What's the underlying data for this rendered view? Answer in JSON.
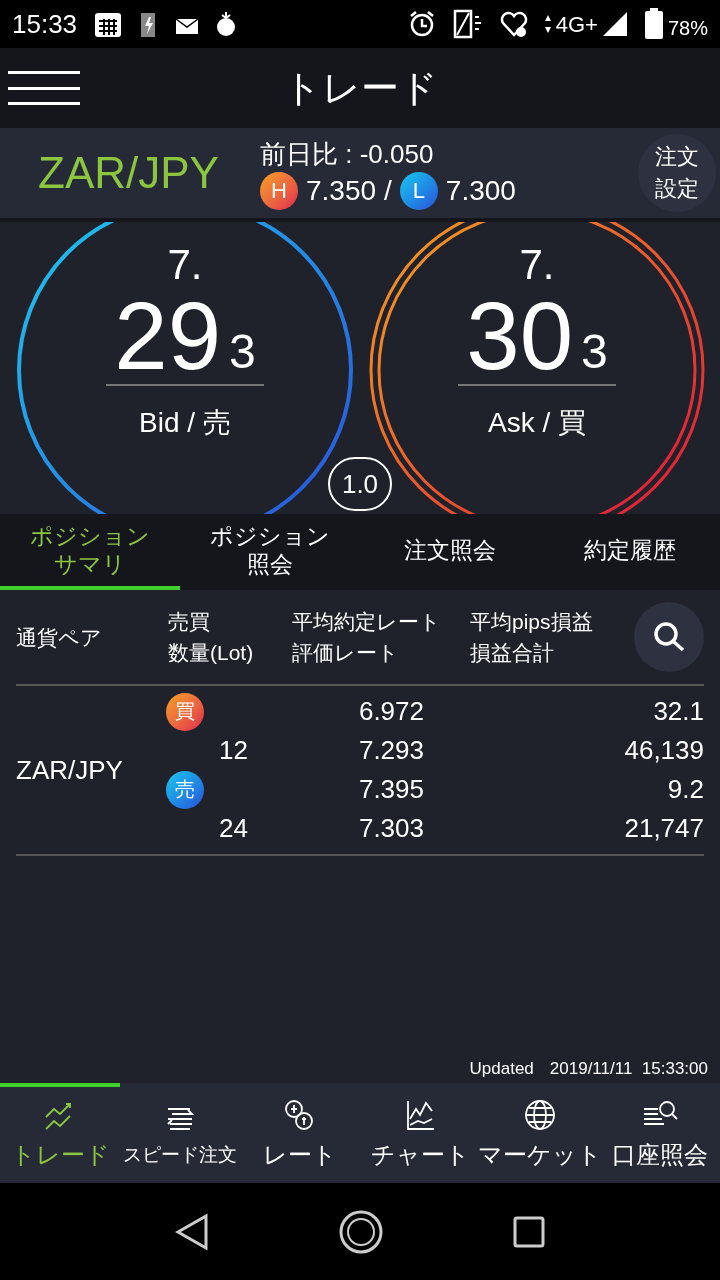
{
  "status_bar": {
    "time": "15:33",
    "network": "4G+",
    "battery": "78%"
  },
  "header": {
    "title": "トレード"
  },
  "pair_info": {
    "pair": "ZAR/JPY",
    "change": "前日比 : -0.050",
    "high_label": "H",
    "high": "7.350",
    "separator": "/",
    "low_label": "L",
    "low": "7.300",
    "order_settings": "注文設定"
  },
  "quotes": [
    {
      "kind": "bid",
      "prefix": "7.",
      "big": "29",
      "small": "3",
      "label": "Bid / 売"
    },
    {
      "kind": "ask",
      "prefix": "7.",
      "big": "30",
      "small": "3",
      "label": "Ask / 買"
    }
  ],
  "lot": "1.0",
  "tabs": [
    {
      "label": "ポジションサマリ",
      "selected": true
    },
    {
      "label": "ポジション照会",
      "selected": false
    },
    {
      "label": "注文照会",
      "selected": false
    },
    {
      "label": "約定履歴",
      "selected": false
    }
  ],
  "table": {
    "columns": [
      [
        "通貨ペア"
      ],
      [
        "売買",
        "数量(Lot)"
      ],
      [
        "平均約定レート",
        "評価レート"
      ],
      [
        "平均pips損益",
        "損益合計"
      ]
    ],
    "rows": [
      {
        "pair": "ZAR/JPY",
        "positions": [
          {
            "kind": "buy",
            "side": "買",
            "lot": "12",
            "avg_rate": "6.972",
            "eval_rate": "7.293",
            "pips": "32.1",
            "total": "46,139"
          },
          {
            "kind": "sell",
            "side": "売",
            "lot": "24",
            "avg_rate": "7.395",
            "eval_rate": "7.303",
            "pips": "9.2",
            "total": "21,747"
          }
        ]
      }
    ]
  },
  "updated": {
    "label": "Updated",
    "time": "2019/11/11  15:33:00"
  },
  "nav": [
    {
      "kind": "trade",
      "label": "トレード",
      "selected": true
    },
    {
      "kind": "speed",
      "label": "スピード注文",
      "selected": false
    },
    {
      "kind": "rate",
      "label": "レート",
      "selected": false
    },
    {
      "kind": "chart",
      "label": "チャート",
      "selected": false
    },
    {
      "kind": "market",
      "label": "マーケット",
      "selected": false
    },
    {
      "kind": "account",
      "label": "口座照会",
      "selected": false
    }
  ]
}
